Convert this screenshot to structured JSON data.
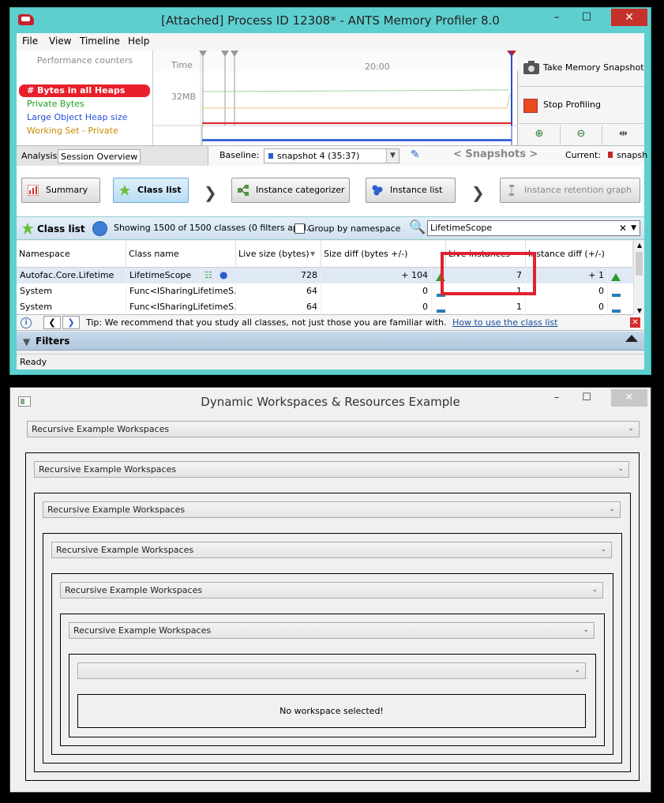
{
  "profiler": {
    "title": "[Attached] Process ID 12308* - ANTS Memory Profiler 8.0",
    "menu": [
      "File",
      "View",
      "Timeline",
      "Help"
    ],
    "menu_underline": [
      "F",
      "V",
      "l",
      "H"
    ],
    "counters_header": "Performance counters",
    "counters": [
      {
        "label": "# Bytes in all Heaps",
        "color": "#ffffff"
      },
      {
        "label": "Private Bytes",
        "color": "#1e9e1e"
      },
      {
        "label": "Large Object Heap size",
        "color": "#2a4fd6"
      },
      {
        "label": "Working Set - Private",
        "color": "#c98a00"
      }
    ],
    "timeline": {
      "time_label": "Time",
      "time_value": "20:00",
      "mem_label": "32MB"
    },
    "take_snapshot": "Take Memory Snapshot",
    "stop_profiling": "Stop Profiling",
    "tabs": [
      "Analysis",
      "Session Overview"
    ],
    "baseline_label": "Baseline:",
    "baseline_value": "snapshot 4 (35:37)",
    "snapshots_nav": "< Snapshots >",
    "current_label": "Current:",
    "current_value": "snapsh",
    "nav_buttons": [
      "Summary",
      "Class list",
      "Instance categorizer",
      "Instance list",
      "Instance retention graph"
    ],
    "class_list": {
      "title": "Class list",
      "showing": "Showing 1500 of 1500 classes (0 filters appl...",
      "group_label": "Group by namespace",
      "search_value": "LifetimeScope",
      "columns": [
        "Namespace",
        "Class name",
        "Live size (bytes)",
        "Size diff (bytes +/-)",
        "Live instances",
        "Instance diff (+/-)"
      ],
      "rows": [
        [
          "Autofac.Core.Lifetime",
          "LifetimeScope",
          "728",
          "+ 104",
          "7",
          "+ 1"
        ],
        [
          "System",
          "Func<ISharingLifetimeS...",
          "64",
          "0",
          "1",
          "0"
        ],
        [
          "System",
          "Func<ISharingLifetimeS...",
          "64",
          "0",
          "1",
          "0"
        ]
      ]
    },
    "tip": "Tip: We recommend that you study all classes, not just those you are familiar with.",
    "tip_link": "How to use the class list",
    "filters": "Filters",
    "status": "Ready"
  },
  "workspaces": {
    "title": "Dynamic Workspaces & Resources Example",
    "combos": [
      "Recursive Example Workspaces",
      "Recursive Example Workspaces",
      "Recursive Example Workspaces",
      "Recursive Example Workspaces",
      "Recursive Example Workspaces",
      "Recursive Example Workspaces",
      ""
    ],
    "empty_message": "No workspace selected!"
  },
  "colors": {
    "accent_red": "#e3202d",
    "title_bar": "#5ecfcf"
  }
}
